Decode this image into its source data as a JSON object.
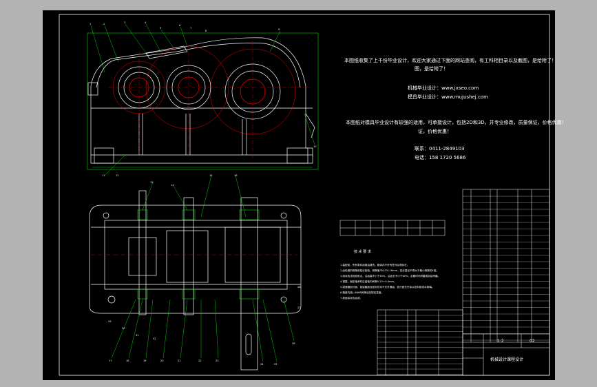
{
  "colors": {
    "bg": "#b3b3b3",
    "sheet": "#000000",
    "outline": "#ffffff",
    "green": "#00ff00",
    "red": "#ff0000",
    "yellow": "#ffff00",
    "cyan": "#00ffff",
    "magenta": "#ff00ff"
  },
  "notice": {
    "line1": "本图纸收集了上千份毕业设计，欢迎大家通过下面的网站查阅，有工科相目录以及截图，是给附了！",
    "line2": "图，是给附了！",
    "site1": "机械毕业设计：www.jxseo.com",
    "site2": "模具毕业设计：www.mujushej.com",
    "line3": "本图纸对模具毕业设计有较强的适用，可承接设计，包括2D和3D，并专业修改，质量保证，价格优惠！",
    "line4": "证，价格优惠！",
    "phone": "联系：0411-2849103",
    "mobile": "电话：158 1720 5686"
  },
  "tech_req_title": "技 术 要 求",
  "tech_req_lines": [
    "1.装配前，所有零件用煤油清洗，箱体内不许有任何杂物存在。",
    "2.齿轮副的侧隙用铅丝检验，侧隙值不小于0.16mm，铅丝直径不得大于最小侧隙的4倍。",
    "3.用涂色法检验斑点，沿齿高不小于45%，沿齿长不小于60%，必要时可研磨或刮后研磨。",
    "4.调整、固定轴承时应留轴向间隙0.25～0.4mm。",
    "5.减速器剖分面、各接触面及密封处均不允许漏油，剖分面允许涂以密封胶或水玻璃。",
    "6.箱座内装L-AN68润滑油至规定高度。",
    "7.表面涂灰色油漆。"
  ],
  "title_block": {
    "scale": "1:2",
    "drawing_no": "02",
    "name": "机械设计课程设计"
  },
  "calloutsTop": [
    "1",
    "2",
    "3",
    "4",
    "5",
    "6",
    "7",
    "8",
    "9",
    "10",
    "11",
    "12",
    "13",
    "14",
    "15",
    "16"
  ],
  "calloutsBottom": [
    "17",
    "18",
    "19",
    "20",
    "21",
    "22",
    "23",
    "24",
    "25",
    "26",
    "27",
    "28",
    "29",
    "30",
    "31",
    "32"
  ]
}
